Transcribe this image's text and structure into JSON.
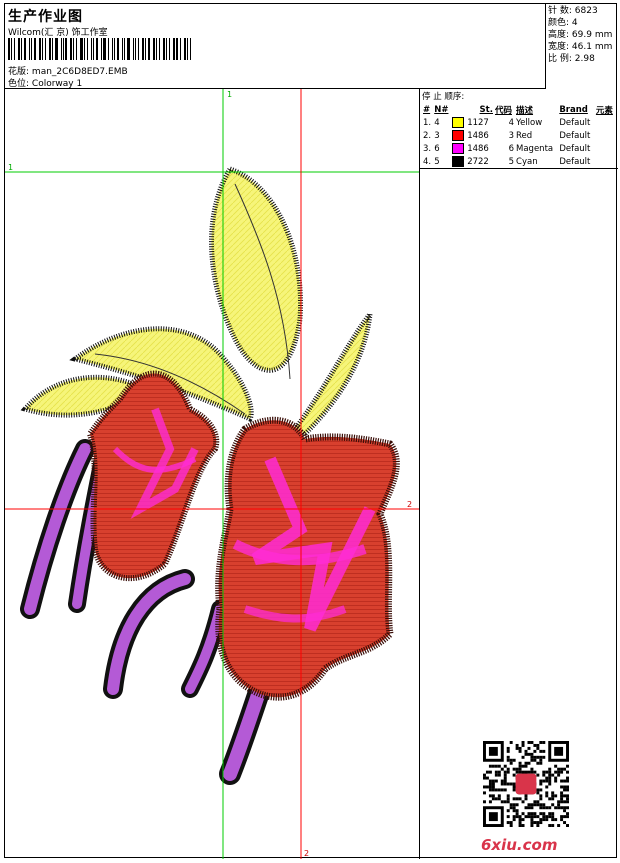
{
  "header": {
    "title": "生产作业图",
    "company": "Wilcom(汇 京) 饰工作室",
    "design_label": "花版:",
    "design_name": "man_2C6D8ED7.EMB",
    "colorway_label": "色位:",
    "colorway_name": "Colorway 1"
  },
  "stats": [
    {
      "label": "针 数:",
      "value": "6823"
    },
    {
      "label": "颜色:",
      "value": "4"
    },
    {
      "label": "高度:",
      "value": "69.9 mm"
    },
    {
      "label": "宽度:",
      "value": "46.1 mm"
    },
    {
      "label": "比 例:",
      "value": "2.98"
    }
  ],
  "stop_sequence": {
    "title": "停 止 顺序:",
    "columns": [
      "#",
      "N#",
      "St.",
      "代码",
      "描述",
      "Brand",
      "元素"
    ],
    "rows": [
      {
        "idx": "1.",
        "n": "4",
        "color": "#ffff00",
        "st": "1127",
        "code": "4",
        "desc": "Yellow",
        "brand": "Default"
      },
      {
        "idx": "2.",
        "n": "3",
        "color": "#ff0000",
        "st": "1486",
        "code": "3",
        "desc": "Red",
        "brand": "Default"
      },
      {
        "idx": "3.",
        "n": "6",
        "color": "#ff00ff",
        "st": "1486",
        "code": "6",
        "desc": "Magenta",
        "brand": "Default"
      },
      {
        "idx": "4.",
        "n": "5",
        "color": "#000000",
        "st": "2722",
        "code": "5",
        "desc": "Cyan",
        "brand": "Default"
      }
    ]
  },
  "guides": {
    "green_label_1": "1",
    "green_label_2": "1",
    "red_label_1": "2",
    "red_label_2": "2"
  },
  "watermark": "6xiu.com",
  "colors": {
    "green_guide": "#00cc00",
    "red_guide": "#ff0000"
  }
}
